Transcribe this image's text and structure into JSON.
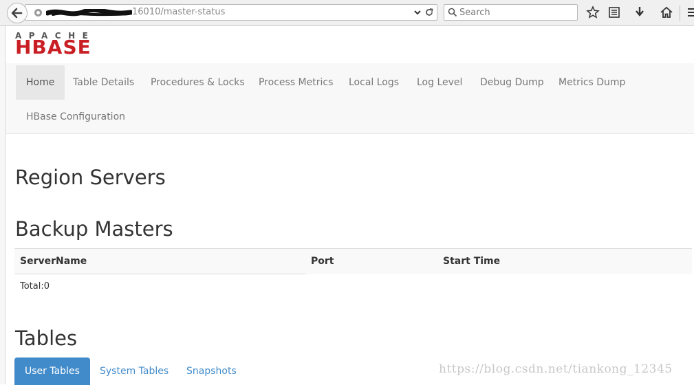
{
  "browser": {
    "url_suffix": "16010/master-status",
    "search_placeholder": "Search"
  },
  "logo": {
    "top": "APACHE",
    "main": "HBASE"
  },
  "nav": {
    "items": [
      "Home",
      "Table Details",
      "Procedures & Locks",
      "Process Metrics",
      "Local Logs",
      "Log Level",
      "Debug Dump",
      "Metrics Dump",
      "HBase Configuration"
    ]
  },
  "sections": {
    "region_servers": "Region Servers",
    "backup_masters": "Backup Masters",
    "tables": "Tables"
  },
  "backup_table": {
    "headers": [
      "ServerName",
      "Port",
      "Start Time"
    ],
    "total": "Total:0"
  },
  "tables_tabs": [
    "User Tables",
    "System Tables",
    "Snapshots"
  ],
  "watermark": "https://blog.csdn.net/tiankong_12345",
  "colors": {
    "brand_red": "#c91e23",
    "accent_blue": "#428bca"
  }
}
